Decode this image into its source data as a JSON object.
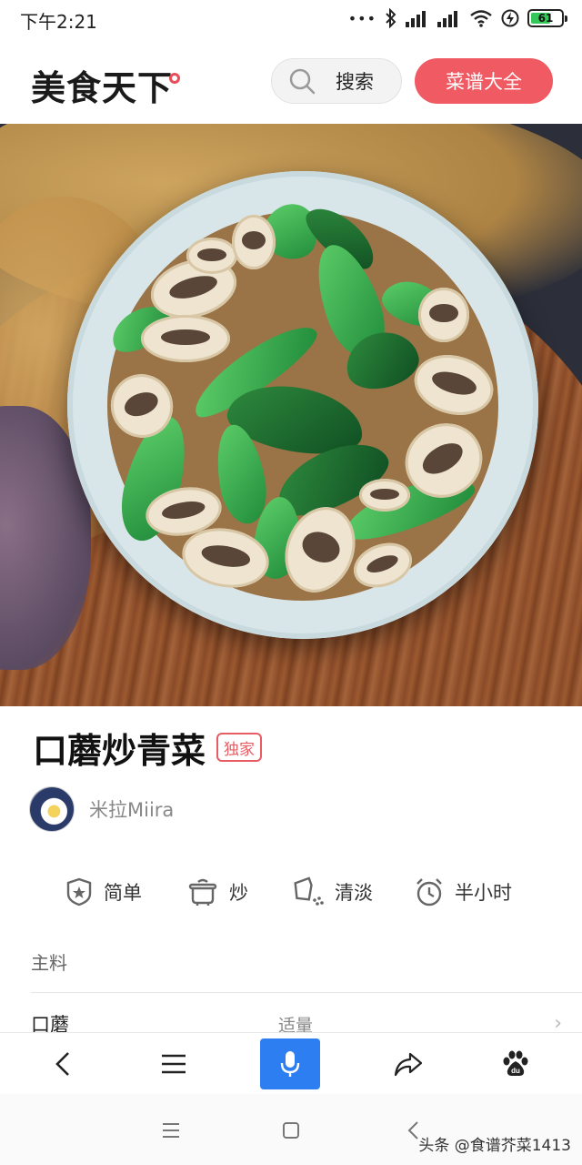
{
  "status_bar": {
    "time": "下午2:21",
    "signal_dots": "•••",
    "battery_level": "61",
    "icons": [
      "bluetooth-icon",
      "signal-icon",
      "signal-icon",
      "wifi-icon",
      "charging-icon",
      "battery-icon"
    ]
  },
  "header": {
    "logo": "美食天下",
    "search_label": "搜索",
    "recipes_label": "菜谱大全"
  },
  "recipe": {
    "title": "口蘑炒青菜",
    "badge": "独家",
    "author": "米拉Miira",
    "tags": [
      {
        "icon": "difficulty-badge-icon",
        "label": "简单"
      },
      {
        "icon": "cooking-pot-icon",
        "label": "炒"
      },
      {
        "icon": "seasoning-icon",
        "label": "清淡"
      },
      {
        "icon": "alarm-clock-icon",
        "label": "半小时"
      }
    ],
    "section_label": "主料",
    "ingredients": [
      {
        "name": "口蘑",
        "quantity": "适量"
      }
    ]
  },
  "toolbar": {
    "items": [
      "back-icon",
      "menu-icon",
      "microphone-icon",
      "share-icon",
      "baidu-paw-icon"
    ],
    "baidu_text": "du"
  },
  "system_nav": {
    "items": [
      "menu-icon",
      "home-square-icon",
      "back-icon"
    ],
    "watermark": "头条 @食谱芥菜1413"
  },
  "colors": {
    "accent": "#ef5a63",
    "voice_button": "#2d7ef0",
    "battery": "#34c759"
  }
}
